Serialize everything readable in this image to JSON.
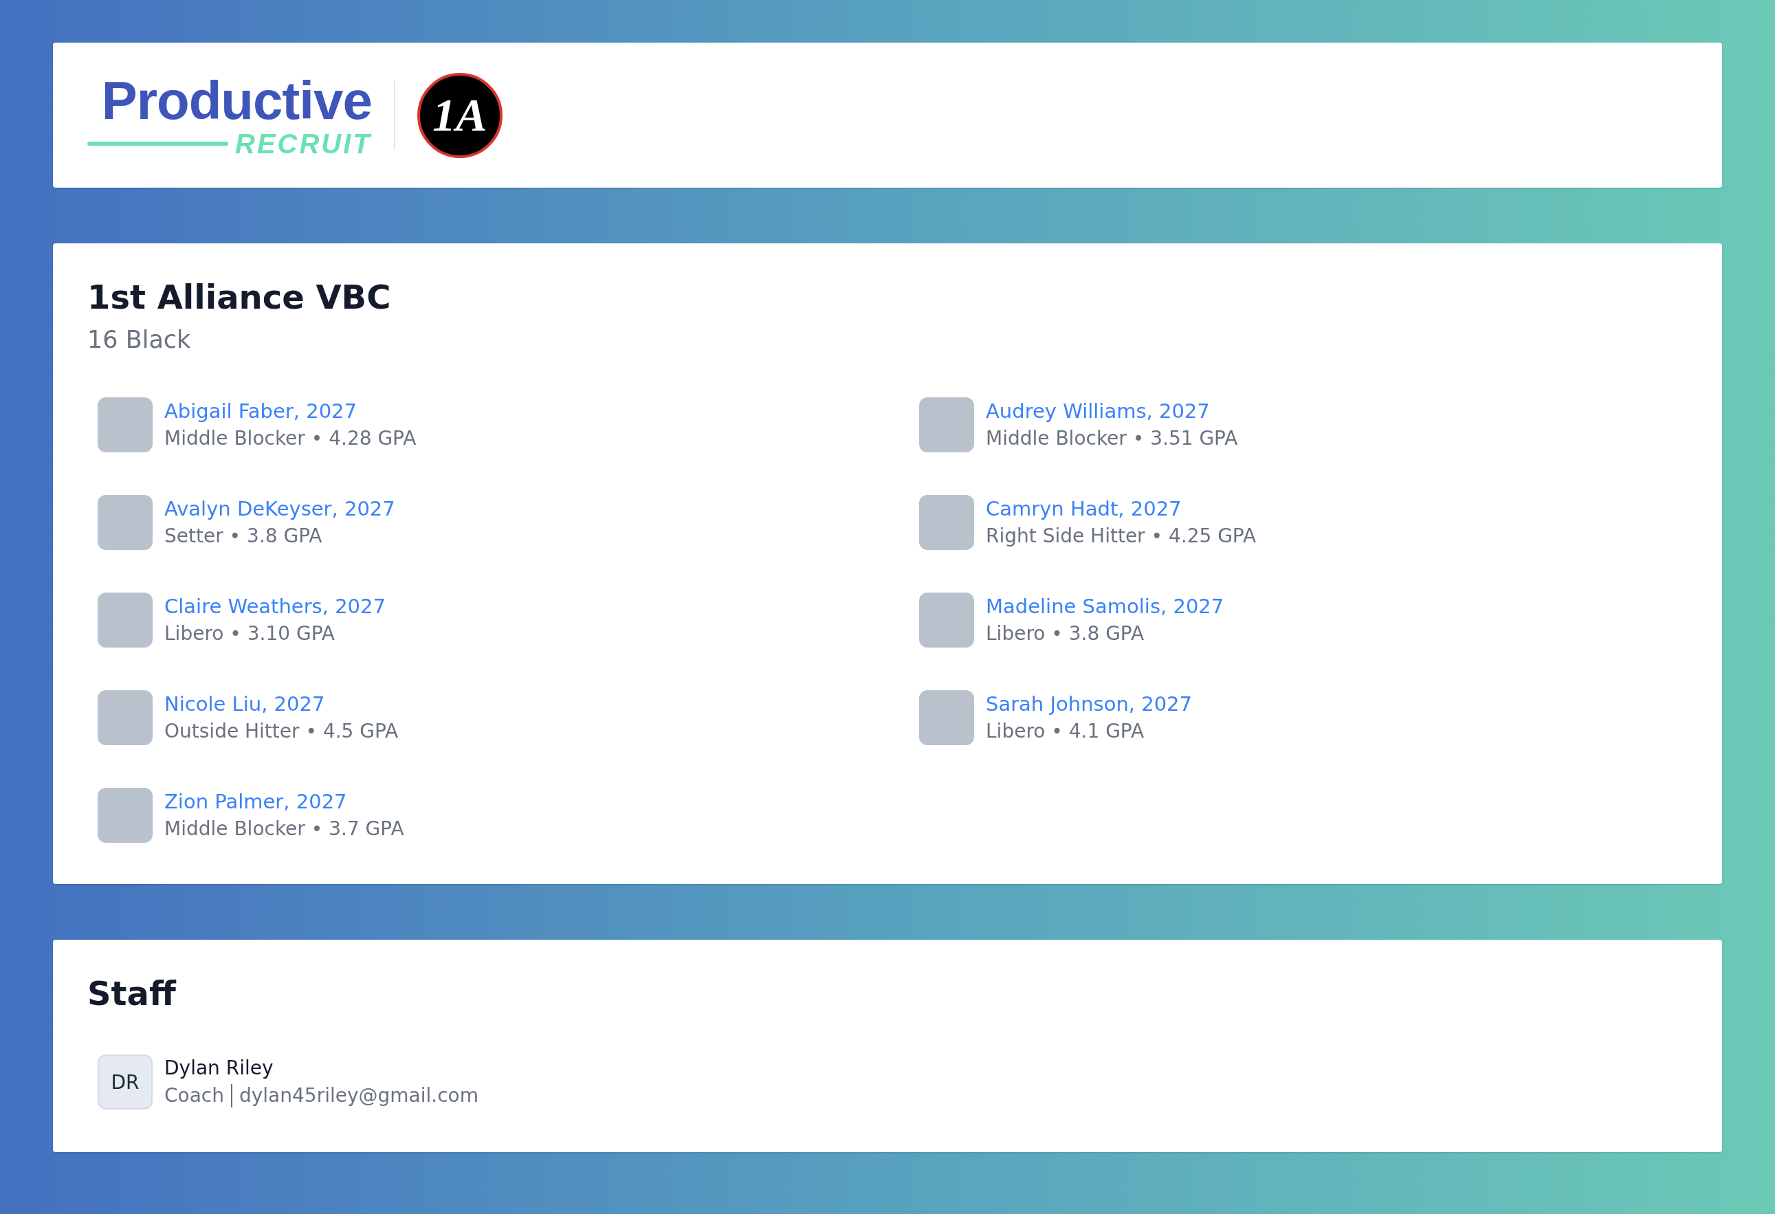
{
  "header": {
    "logo_word": "Productive",
    "logo_sub": "RECRUIT",
    "club_badge": "1A"
  },
  "team": {
    "title": "1st Alliance VBC",
    "subtitle": "16 Black",
    "players": [
      {
        "name": "Abigail Faber, 2027",
        "detail": "Middle Blocker • 4.28 GPA"
      },
      {
        "name": "Audrey Williams, 2027",
        "detail": "Middle Blocker • 3.51 GPA"
      },
      {
        "name": "Avalyn DeKeyser, 2027",
        "detail": "Setter • 3.8 GPA"
      },
      {
        "name": "Camryn Hadt, 2027",
        "detail": "Right Side Hitter • 4.25 GPA"
      },
      {
        "name": "Claire Weathers, 2027",
        "detail": "Libero • 3.10 GPA"
      },
      {
        "name": "Madeline Samolis, 2027",
        "detail": "Libero • 3.8 GPA"
      },
      {
        "name": "Nicole Liu, 2027",
        "detail": "Outside Hitter • 4.5 GPA"
      },
      {
        "name": "Sarah Johnson, 2027",
        "detail": "Libero • 4.1 GPA"
      },
      {
        "name": "Zion Palmer, 2027",
        "detail": "Middle Blocker • 3.7 GPA"
      }
    ]
  },
  "staff": {
    "title": "Staff",
    "members": [
      {
        "initials": "DR",
        "name": "Dylan Riley",
        "role": "Coach",
        "email": "dylan45riley@gmail.com"
      }
    ]
  }
}
